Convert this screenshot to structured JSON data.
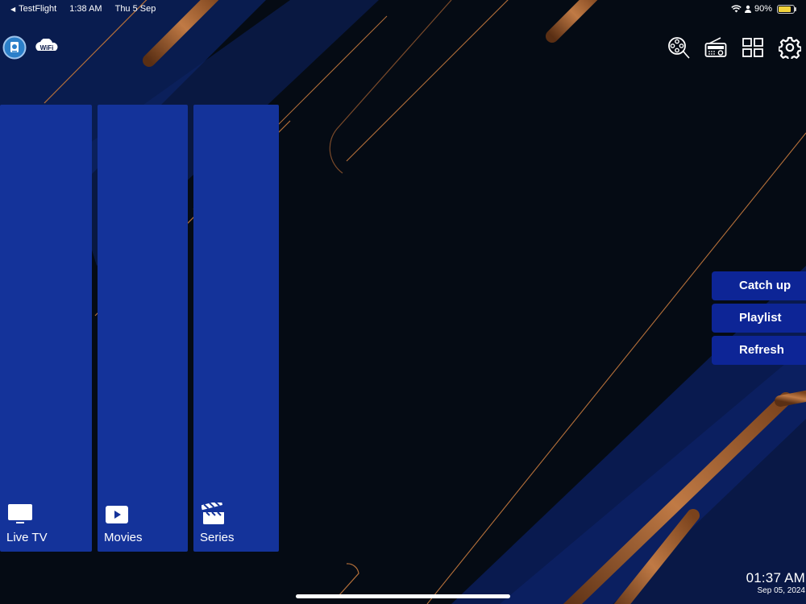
{
  "status_bar": {
    "back_app": "TestFlight",
    "time": "1:38 AM",
    "date": "Thu 5 Sep",
    "battery": "90%",
    "battery_level": 0.9
  },
  "top_left_icons": [
    "app-logo-icon",
    "wifi-badge-icon"
  ],
  "wifi_badge_text": "WiFi",
  "top_right_icons": [
    "film-reel-icon",
    "radio-icon",
    "grid-icon",
    "gear-icon"
  ],
  "tiles": [
    {
      "label": "Live TV",
      "icon": "tv-icon"
    },
    {
      "label": "Movies",
      "icon": "play-icon"
    },
    {
      "label": "Series",
      "icon": "clapperboard-icon"
    }
  ],
  "side_menu": {
    "catch_up": "Catch up",
    "playlist": "Playlist",
    "refresh": "Refresh"
  },
  "clock": {
    "time": "01:37 AM",
    "date": "Sep 05, 2024"
  },
  "colors": {
    "tile": "#14339a",
    "side_button": "#0d2596",
    "background": "#050b14",
    "accent_copper": "#b5703a"
  }
}
